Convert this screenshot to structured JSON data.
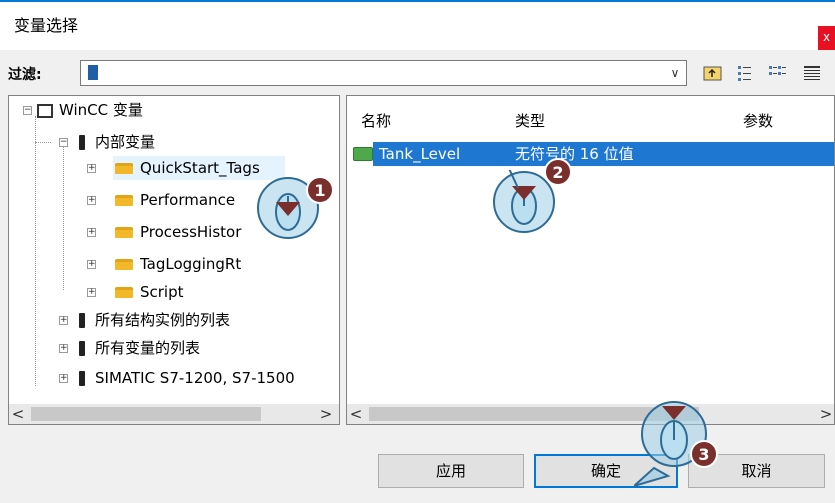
{
  "window": {
    "title": "变量选择",
    "close_label": "x"
  },
  "filter": {
    "label": "过滤:",
    "value": "*"
  },
  "toolbar": {
    "up_icon": "folder-up-icon",
    "list_icon": "list-view-icon",
    "details_icon": "details-view-icon",
    "grid_icon": "grid-view-icon"
  },
  "tree": {
    "root": "WinCC 变量",
    "internal": "内部变量",
    "groups": [
      "QuickStart_Tags",
      "Performance",
      "ProcessHistor",
      "TagLoggingRt",
      "Script"
    ],
    "struct_list": "所有结构实例的列表",
    "all_tags": "所有变量的列表",
    "plc": "SIMATIC S7-1200, S7-1500"
  },
  "list": {
    "columns": [
      "名称",
      "类型",
      "参数"
    ],
    "rows": [
      {
        "name": "Tank_Level",
        "type": "无符号的 16 位值"
      }
    ]
  },
  "buttons": {
    "apply": "应用",
    "ok": "确定",
    "cancel": "取消"
  },
  "callouts": [
    "1",
    "2",
    "3"
  ]
}
